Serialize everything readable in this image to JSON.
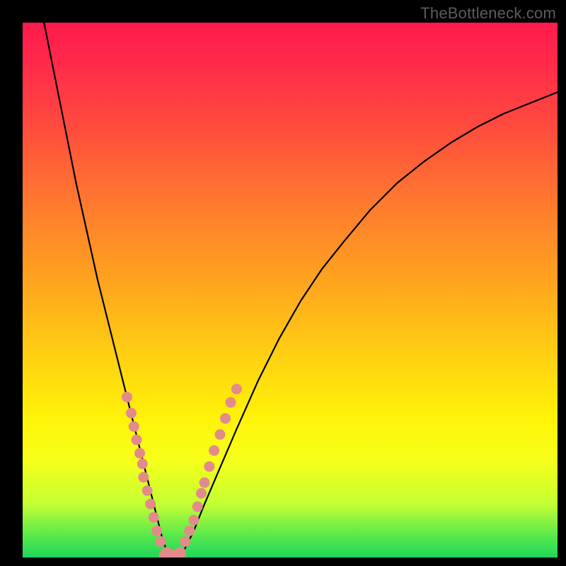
{
  "watermark": "TheBottleneck.com",
  "chart_data": {
    "type": "line",
    "title": "",
    "xlabel": "",
    "ylabel": "",
    "xlim": [
      0,
      100
    ],
    "ylim": [
      0,
      100
    ],
    "series": [
      {
        "name": "curve",
        "x": [
          4,
          6,
          8,
          10,
          12,
          14,
          16,
          18,
          20,
          22,
          23,
          24,
          25,
          26,
          27,
          28.5,
          30,
          32,
          34,
          37,
          40,
          44,
          48,
          52,
          56,
          60,
          65,
          70,
          75,
          80,
          85,
          90,
          95,
          100
        ],
        "y": [
          100,
          90,
          80,
          70,
          61,
          52,
          44,
          36,
          28,
          20,
          16,
          12,
          8,
          4,
          1,
          0,
          1,
          5,
          10,
          17,
          24,
          33,
          41,
          48,
          54,
          59,
          65,
          70,
          74,
          77.5,
          80.5,
          83,
          85,
          87
        ]
      }
    ],
    "markers": [
      {
        "name": "left-branch-dots",
        "color": "#e38b8b",
        "points": [
          {
            "x": 19.5,
            "y": 30.0
          },
          {
            "x": 20.3,
            "y": 27.0
          },
          {
            "x": 20.8,
            "y": 24.5
          },
          {
            "x": 21.3,
            "y": 22.0
          },
          {
            "x": 21.9,
            "y": 19.5
          },
          {
            "x": 22.4,
            "y": 17.5
          },
          {
            "x": 22.6,
            "y": 15.0
          },
          {
            "x": 23.3,
            "y": 12.5
          },
          {
            "x": 23.9,
            "y": 10.0
          },
          {
            "x": 24.5,
            "y": 7.5
          },
          {
            "x": 25.1,
            "y": 5.0
          },
          {
            "x": 25.8,
            "y": 3.0
          },
          {
            "x": 27.0,
            "y": 1.0
          }
        ]
      },
      {
        "name": "right-branch-dots",
        "color": "#e38b8b",
        "points": [
          {
            "x": 29.5,
            "y": 1.0
          },
          {
            "x": 30.4,
            "y": 3.0
          },
          {
            "x": 31.2,
            "y": 5.0
          },
          {
            "x": 32.0,
            "y": 7.0
          },
          {
            "x": 32.7,
            "y": 9.5
          },
          {
            "x": 33.4,
            "y": 12.0
          },
          {
            "x": 34.0,
            "y": 14.0
          },
          {
            "x": 34.9,
            "y": 17.0
          },
          {
            "x": 35.8,
            "y": 20.0
          },
          {
            "x": 36.9,
            "y": 23.0
          },
          {
            "x": 37.9,
            "y": 26.0
          },
          {
            "x": 38.9,
            "y": 29.0
          },
          {
            "x": 40.0,
            "y": 31.5
          }
        ]
      },
      {
        "name": "bottom-cluster-dots",
        "color": "#e38b8b",
        "points": [
          {
            "x": 26.5,
            "y": 0.5
          },
          {
            "x": 27.5,
            "y": 0.5
          },
          {
            "x": 28.5,
            "y": 0.5
          },
          {
            "x": 29.5,
            "y": 0.5
          }
        ]
      }
    ]
  }
}
